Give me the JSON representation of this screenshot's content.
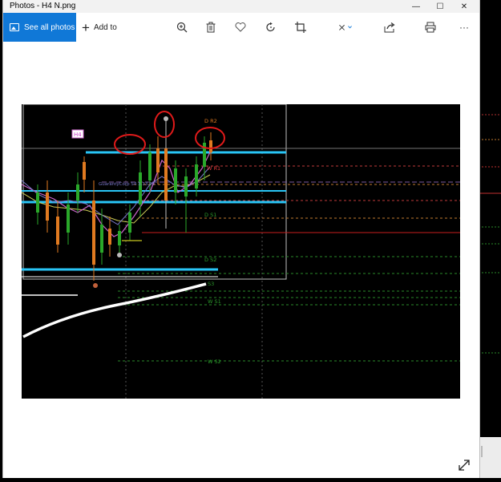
{
  "window": {
    "title": "Photos - H4 N.png",
    "controls": {
      "minimize": "—",
      "maximize": "☐",
      "close": "✕"
    }
  },
  "toolbar": {
    "see_all_label": "See all photos",
    "add_to_label": "Add to",
    "icons": [
      "zoom-in-icon",
      "delete-icon",
      "favorite-icon",
      "rotate-icon",
      "crop-icon",
      "edit-icon",
      "share-icon",
      "print-icon",
      "more-icon"
    ],
    "more_label": "···"
  },
  "chart": {
    "timeframe_tag": "H4",
    "levels": {
      "d_r2": "D R2",
      "d_r1": "D R1",
      "w_r1": "W R1",
      "d_s1": "D S1",
      "d_s2": "D S2",
      "w_s1": "W S1",
      "w_s2": "W S2",
      "s3": "S3"
    },
    "indicator_text": "GuarantyCorp S4 3.33.00"
  },
  "colors": {
    "accent": "#1078d7",
    "chart_bg": "#000000",
    "cyan_line": "#29c5f6",
    "annotation_red": "#e01a1a"
  }
}
